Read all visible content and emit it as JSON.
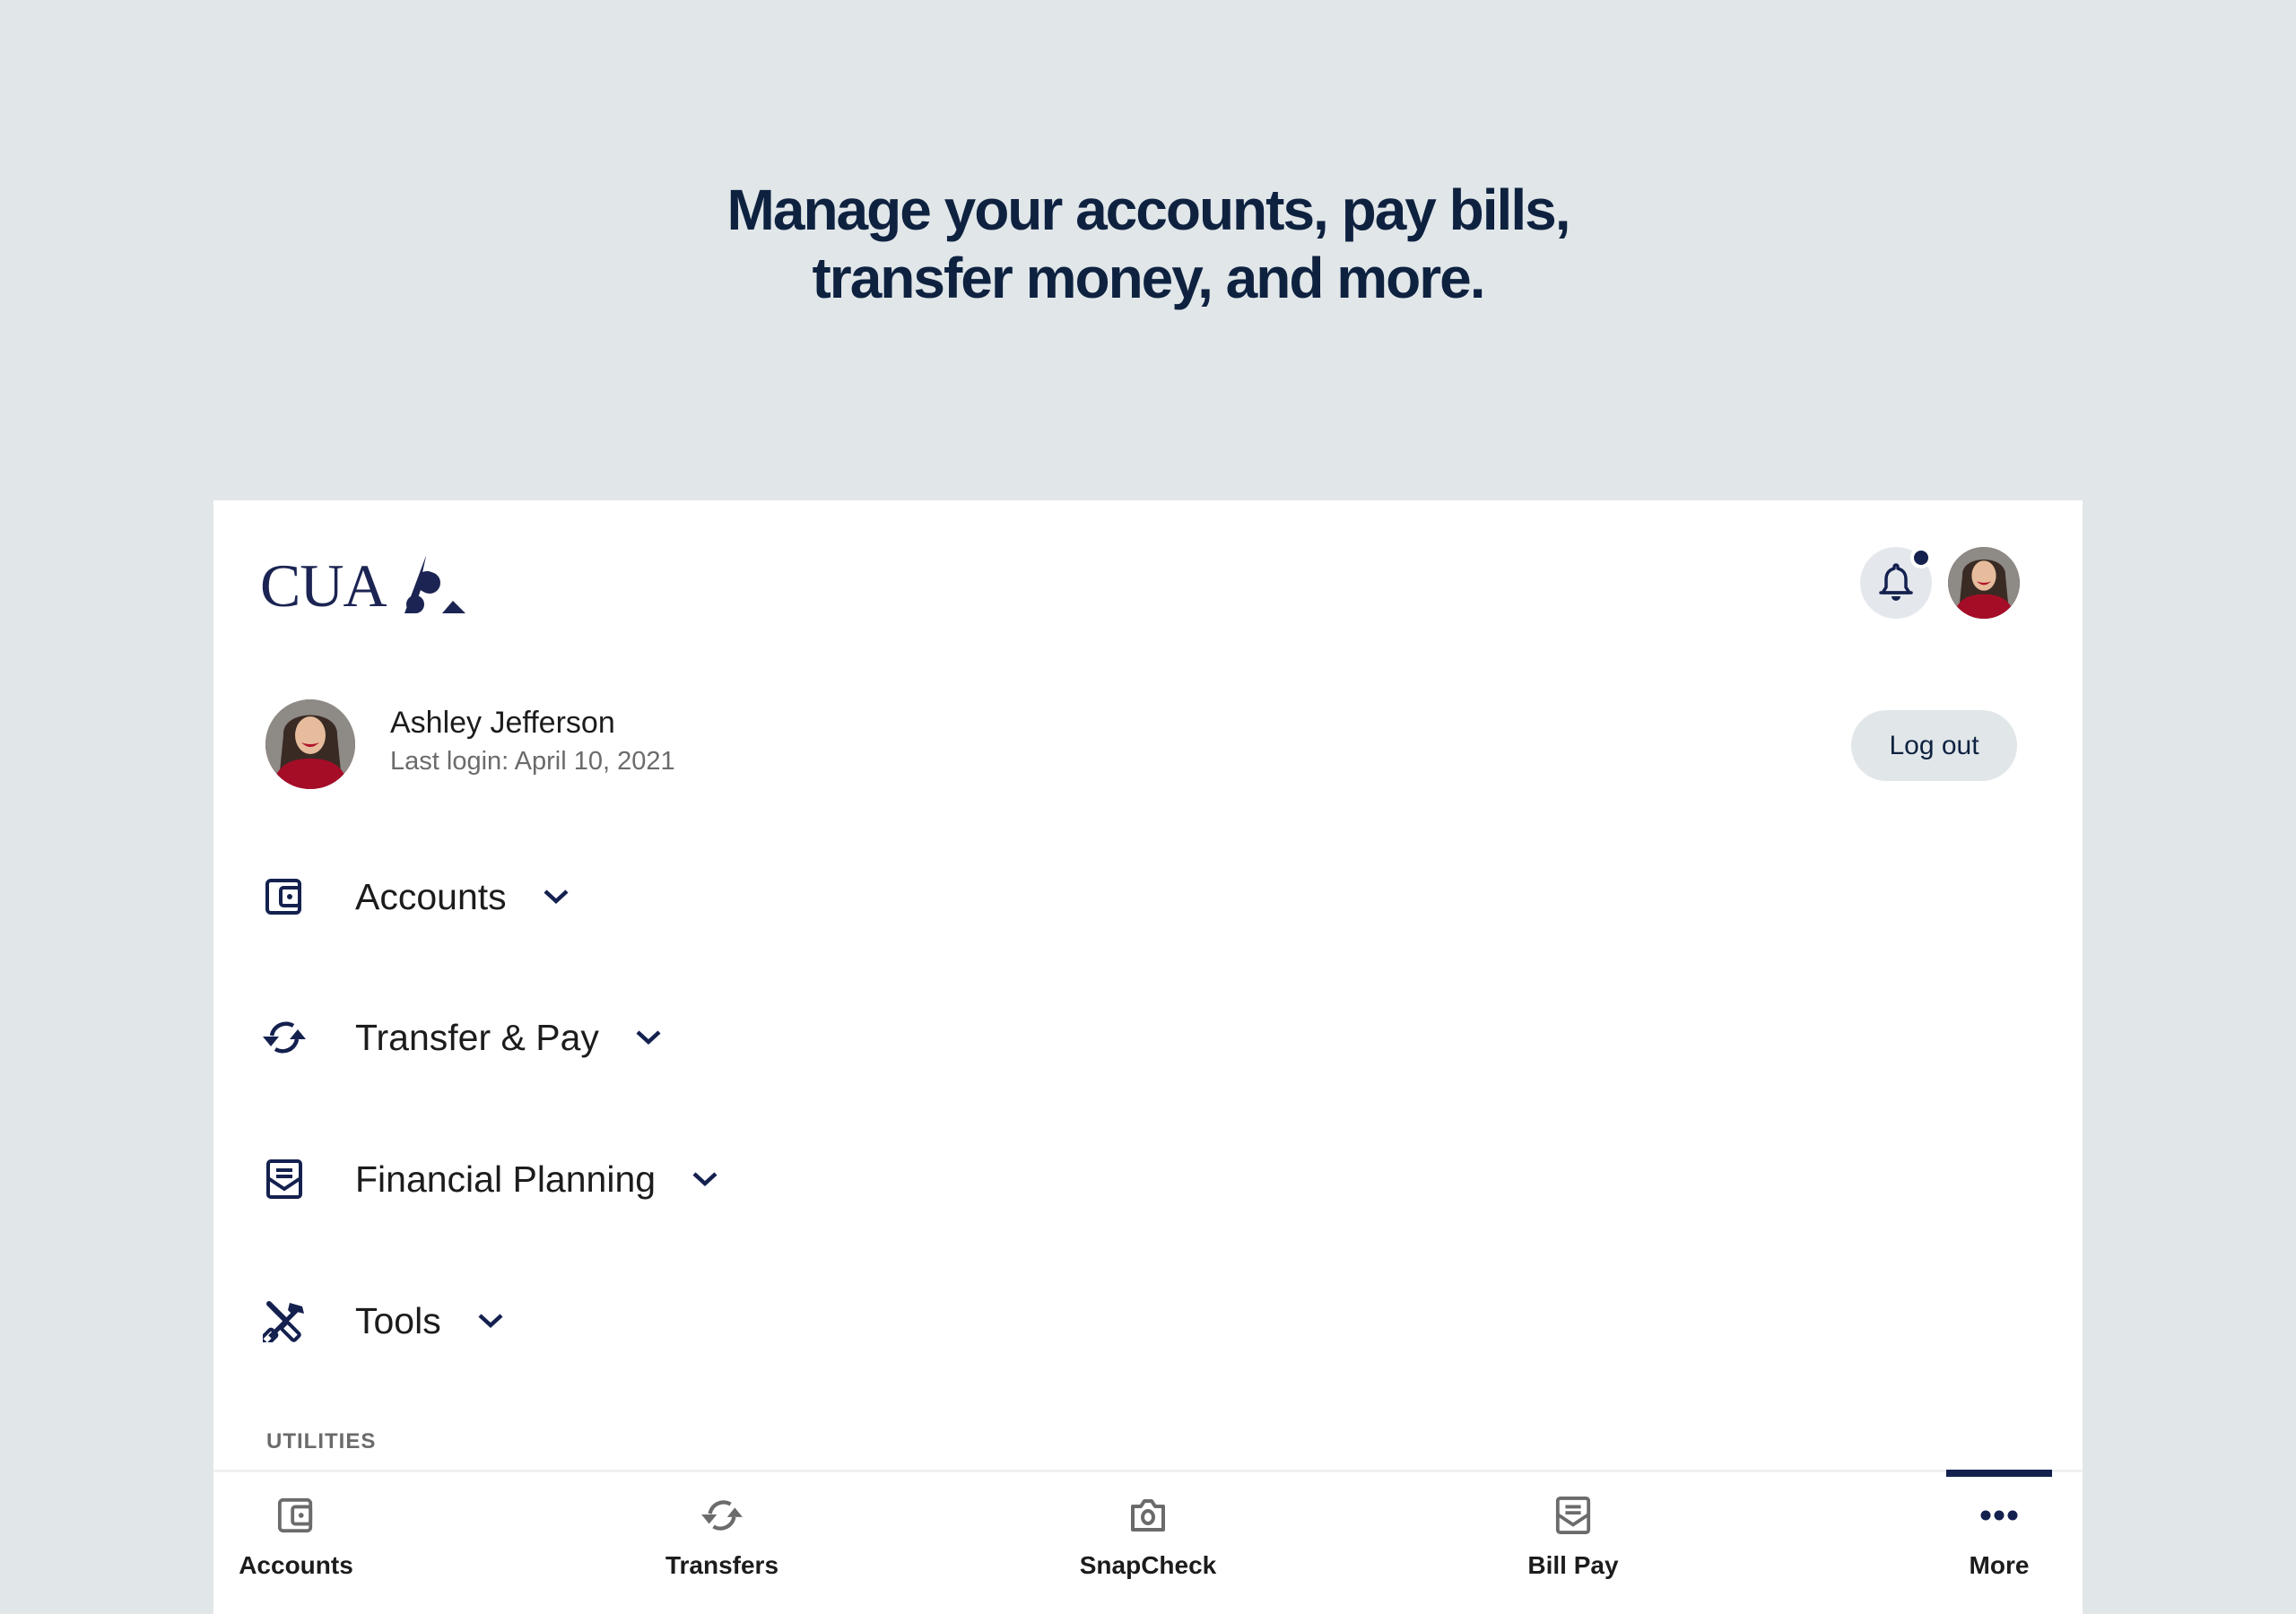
{
  "headline": {
    "line1": "Manage your accounts, pay bills,",
    "line2": "transfer money, and more."
  },
  "header": {
    "logo_text": "CUA",
    "logo_icon": "cua-triangle-logo",
    "notification_icon": "bell-icon",
    "has_unread_notifications": true,
    "profile_avatar": "user-avatar"
  },
  "user": {
    "name": "Ashley Jefferson",
    "last_login": "Last login: April 10, 2021",
    "logout_label": "Log out"
  },
  "menu": [
    {
      "label": "Accounts",
      "icon": "wallet-icon"
    },
    {
      "label": "Transfer & Pay",
      "icon": "sync-arrows-icon"
    },
    {
      "label": "Financial Planning",
      "icon": "envelope-letter-icon"
    },
    {
      "label": "Tools",
      "icon": "tools-icon"
    }
  ],
  "section_label": "UTILITIES",
  "bottom_nav": {
    "active": "More",
    "tabs": [
      {
        "label": "Accounts",
        "icon": "wallet-icon"
      },
      {
        "label": "Transfers",
        "icon": "sync-arrows-icon"
      },
      {
        "label": "SnapCheck",
        "icon": "camera-icon"
      },
      {
        "label": "Bill Pay",
        "icon": "envelope-letter-icon"
      },
      {
        "label": "More",
        "icon": "more-dots-icon"
      }
    ]
  },
  "colors": {
    "background": "#e1e6e9",
    "brand_navy": "#14214f",
    "headline": "#0e2240",
    "inactive_icon": "#6b6b6b"
  }
}
